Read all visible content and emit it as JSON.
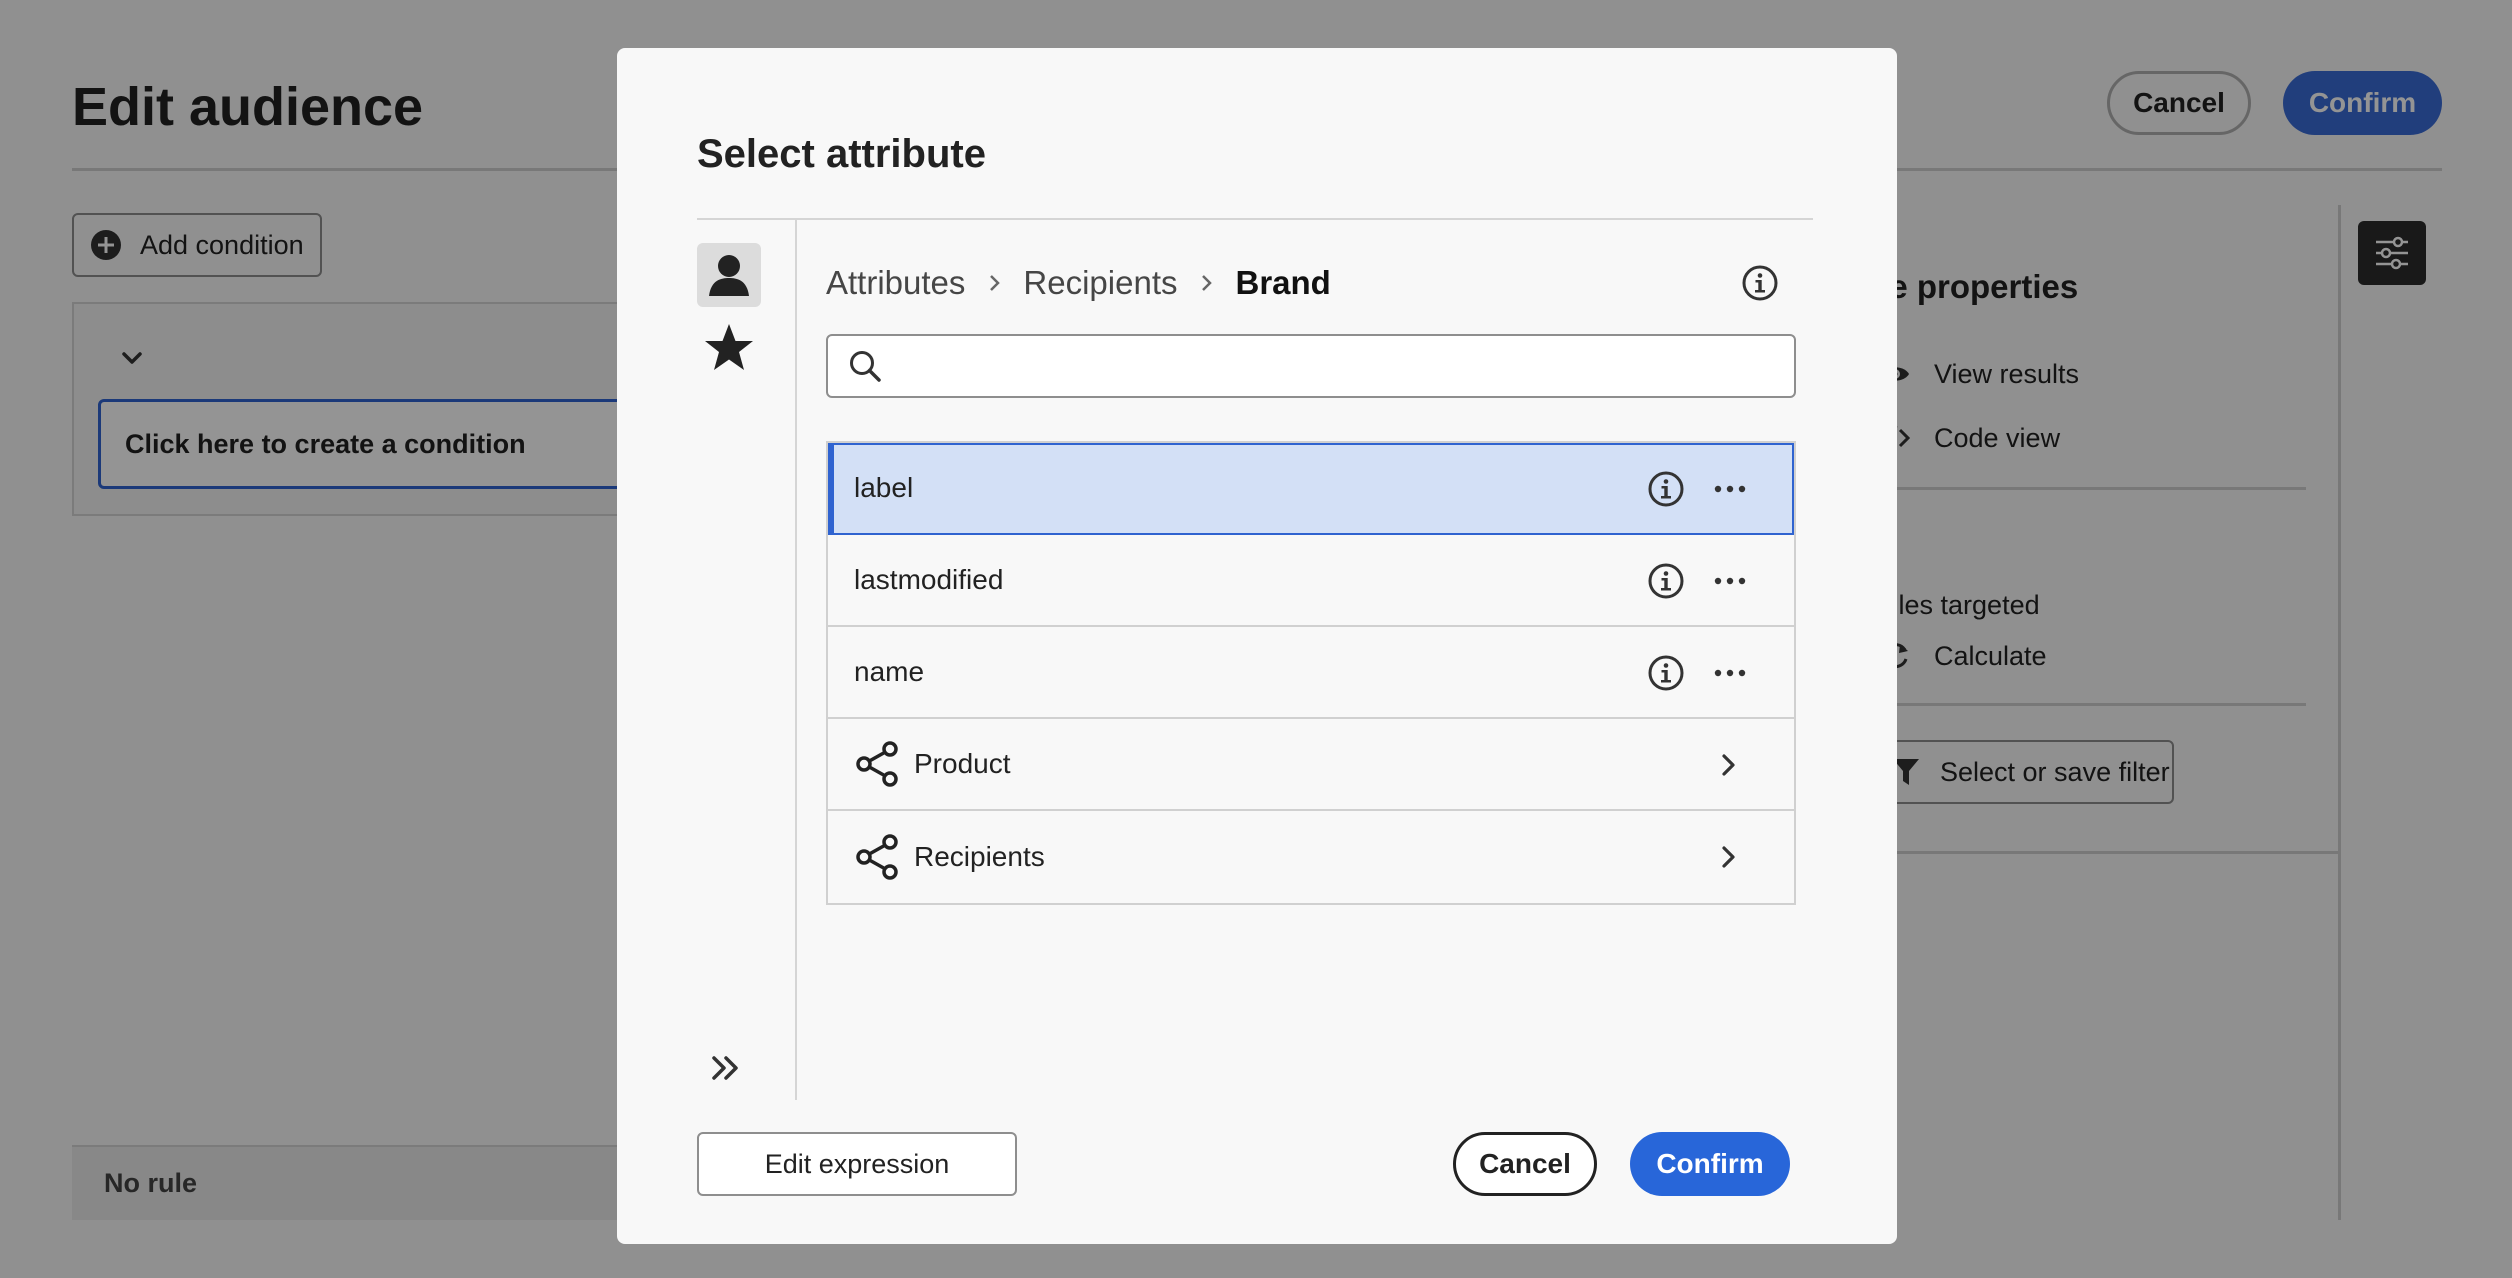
{
  "page": {
    "title": "Edit audience",
    "cancel_label": "Cancel",
    "confirm_label": "Confirm",
    "add_condition_label": "Add condition",
    "condition_placeholder": "Click here to create a condition",
    "no_rule_label": "No rule"
  },
  "rule_panel": {
    "title": "ule properties",
    "view_results_label": "View results",
    "code_view_label": "Code view",
    "profiles_targeted_label": "ofiles targeted",
    "calculate_label": "Calculate",
    "filter_label": "Select or save filter"
  },
  "dialog": {
    "title": "Select attribute",
    "breadcrumb": [
      "Attributes",
      "Recipients",
      "Brand"
    ],
    "search_placeholder": "",
    "attributes": [
      {
        "label": "label",
        "selected": true
      },
      {
        "label": "lastmodified",
        "selected": false
      },
      {
        "label": "name",
        "selected": false
      }
    ],
    "links": [
      {
        "label": "Product"
      },
      {
        "label": "Recipients"
      }
    ],
    "edit_expression_label": "Edit expression",
    "cancel_label": "Cancel",
    "confirm_label": "Confirm"
  },
  "colors": {
    "accent": "#2866d9",
    "selection": "#d3e0f6"
  }
}
